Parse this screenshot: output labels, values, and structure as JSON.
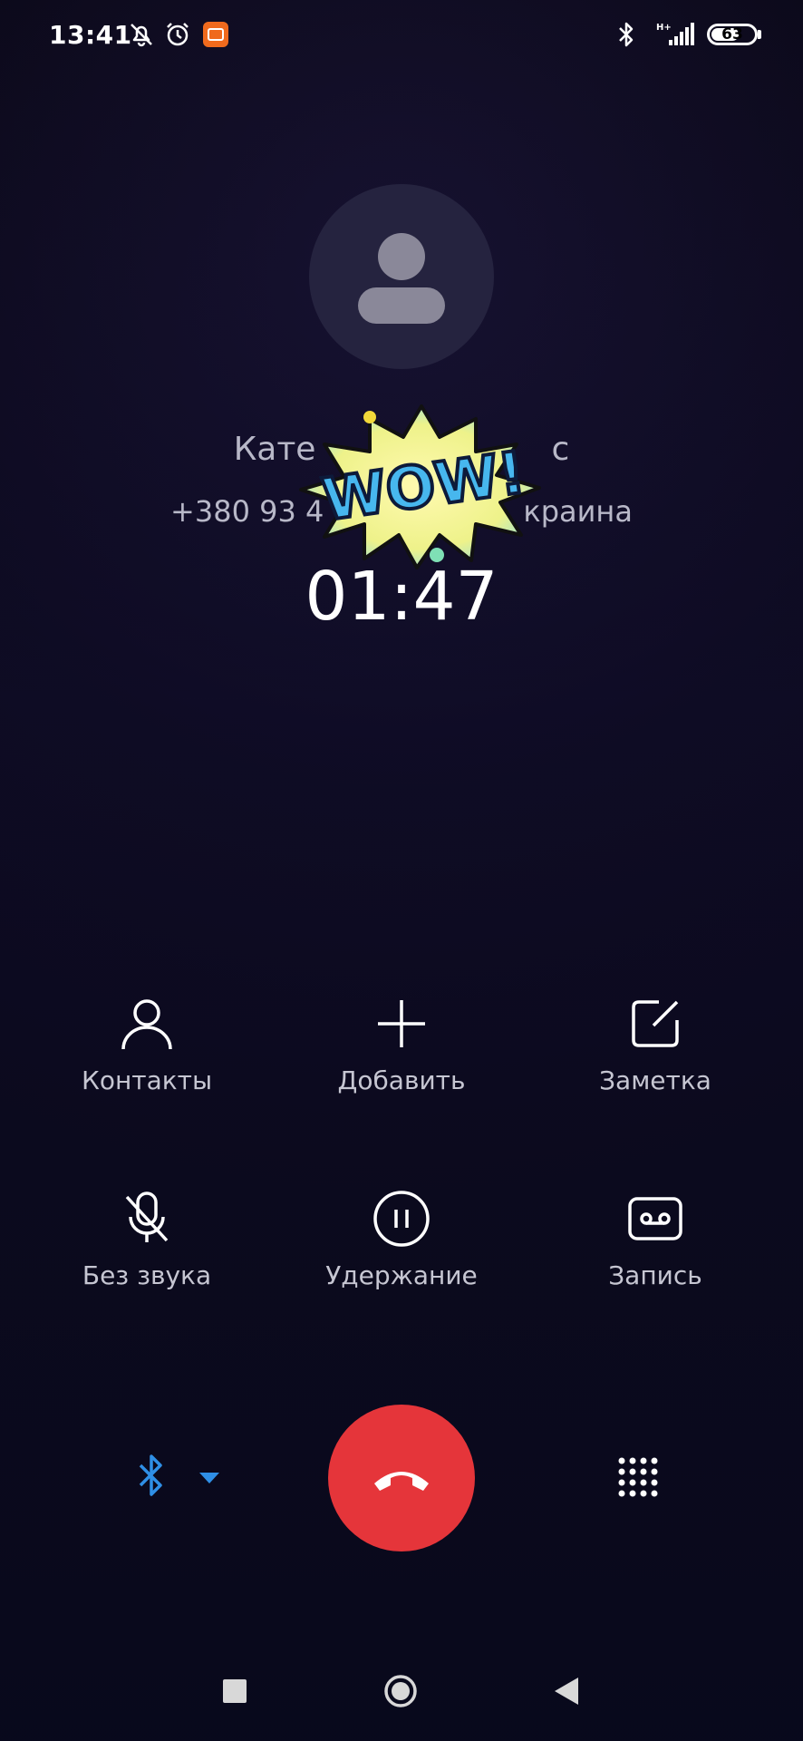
{
  "status_bar": {
    "time": "13:41",
    "battery": "63",
    "network": "H+",
    "icons": [
      "notifications-off-icon",
      "alarm-icon",
      "app-notification-icon",
      "bluetooth-icon",
      "signal-icon",
      "battery-icon"
    ]
  },
  "call": {
    "caller_name": "Кате",
    "caller_name_tail": "с",
    "number_prefix": "+380 93 4",
    "location_tail": "краина",
    "timer": "01:47"
  },
  "sticker": {
    "text": "WOW!"
  },
  "controls": [
    {
      "label": "Контакты",
      "icon": "person-icon"
    },
    {
      "label": "Добавить",
      "icon": "plus-icon"
    },
    {
      "label": "Заметка",
      "icon": "note-icon"
    },
    {
      "label": "Без звука",
      "icon": "mic-off-icon"
    },
    {
      "label": "Удержание",
      "icon": "pause-icon"
    },
    {
      "label": "Запись",
      "icon": "record-icon"
    }
  ],
  "colors": {
    "end_call": "#e5353a",
    "bluetooth": "#2f8fe6",
    "label": "#c6c6d2"
  }
}
